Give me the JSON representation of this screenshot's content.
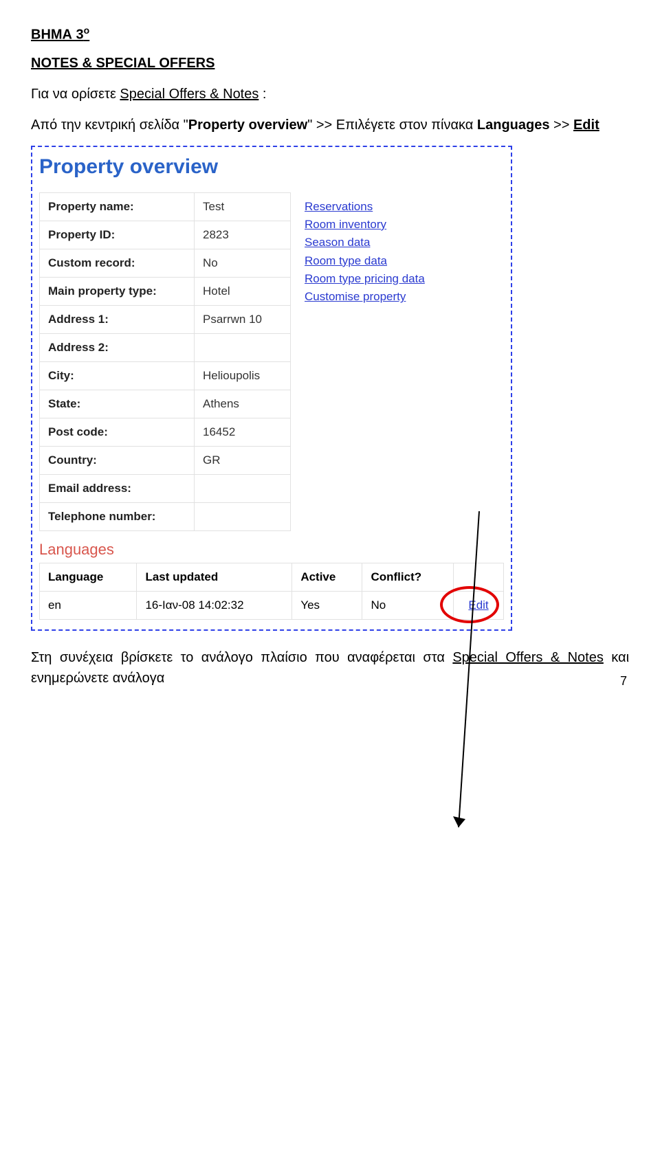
{
  "step_label_base": "ΒΗΜΑ 3",
  "step_label_sup": "ο",
  "section_title": "NOTES & SPECIAL OFFERS",
  "intro_prefix": "Για να ορίσετε ",
  "intro_underlined": "Special Offers & Notes",
  "intro_suffix": " :",
  "instr_1": "Από την κεντρική σελίδα \"",
  "instr_bold": "Property overview",
  "instr_2": "\" >> Επιλέγετε στον πίνακα ",
  "instr_lang": "Languages",
  "instr_3": "  >> ",
  "instr_edit": " Edit",
  "panel_heading": "Property overview",
  "property_fields": [
    {
      "label": "Property name:",
      "value": "Test"
    },
    {
      "label": "Property ID:",
      "value": "2823"
    },
    {
      "label": "Custom record:",
      "value": "No"
    },
    {
      "label": "Main property type:",
      "value": "Hotel"
    },
    {
      "label": "Address 1:",
      "value": "Psarrwn 10"
    },
    {
      "label": "Address 2:",
      "value": ""
    },
    {
      "label": "City:",
      "value": "Helioupolis"
    },
    {
      "label": "State:",
      "value": "Athens"
    },
    {
      "label": "Post code:",
      "value": "16452"
    },
    {
      "label": "Country:",
      "value": "GR"
    },
    {
      "label": "Email address:",
      "value": ""
    },
    {
      "label": "Telephone number:",
      "value": ""
    }
  ],
  "side_links": [
    "Reservations",
    "Room inventory",
    "Season data",
    "Room type data",
    "Room type pricing data",
    "Customise property"
  ],
  "lang_heading": "Languages",
  "lang_cols": [
    "Language",
    "Last updated",
    "Active",
    "Conflict?",
    ""
  ],
  "lang_row": {
    "language": "en",
    "last_updated": "16-Ιαν-08 14:02:32",
    "active": "Yes",
    "conflict": "No",
    "edit": "Edit"
  },
  "outro_1": "Στη συνέχεια βρίσκετε το ανάλογο πλαίσιο που αναφέρεται στα ",
  "outro_u": "Special Offers & Notes",
  "outro_2": "  και ενημερώνετε ανάλογα",
  "page_num": "7"
}
